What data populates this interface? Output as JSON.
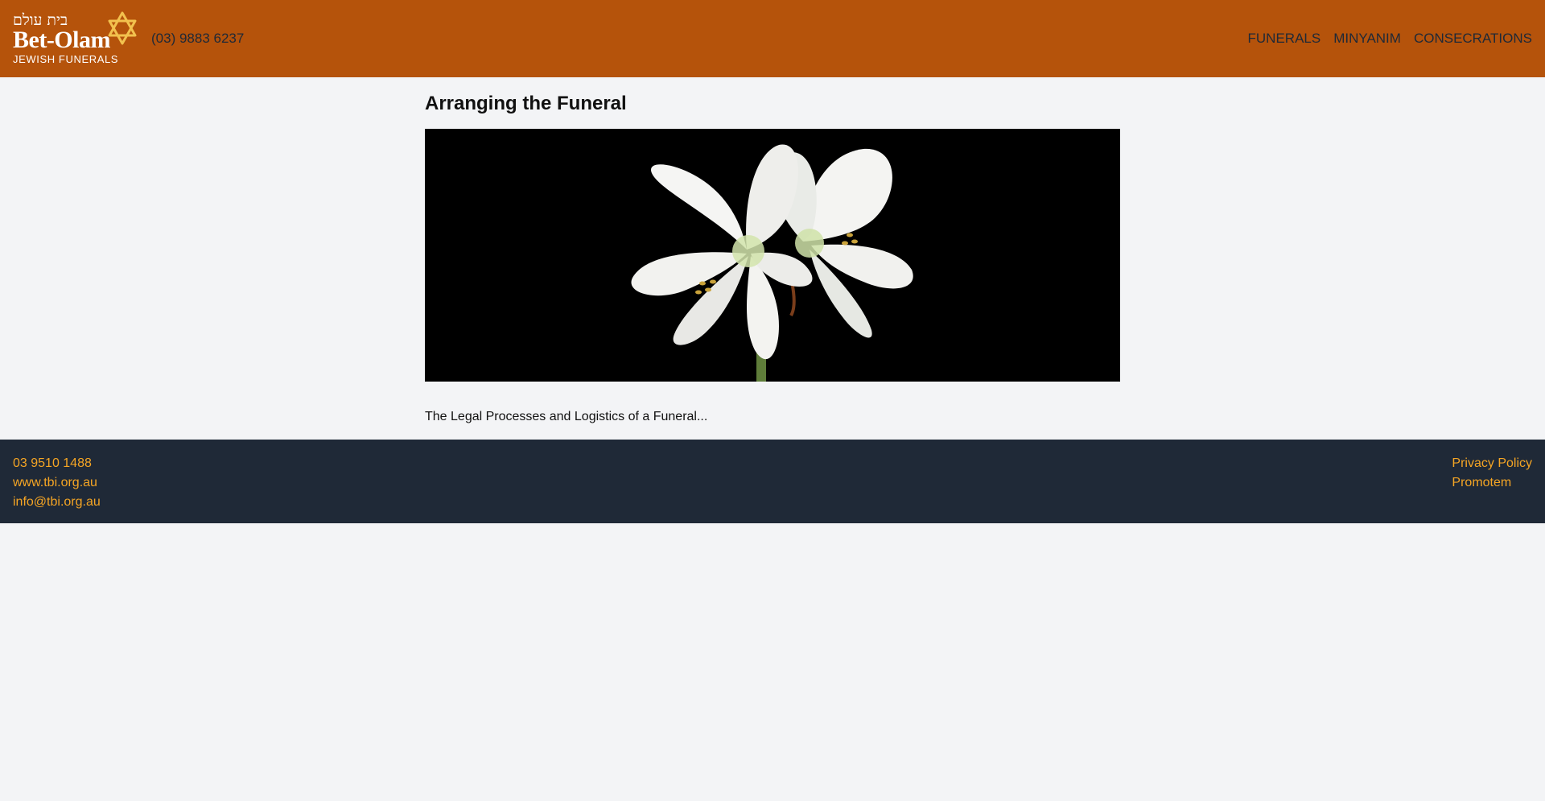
{
  "header": {
    "logo": {
      "hebrew": "בית עולם",
      "brand": "Bet-Olam",
      "tagline": "JEWISH FUNERALS",
      "icon": "star-of-david-icon"
    },
    "phone": "(03) 9883 6237",
    "nav": [
      "FUNERALS",
      "MINYANIM",
      "CONSECRATIONS"
    ]
  },
  "main": {
    "title": "Arranging the Funeral",
    "hero_image": "white lily flowers on black background",
    "intro": "The Legal Processes and Logistics of a Funeral..."
  },
  "footer": {
    "contact": [
      "03 9510 1488",
      "www.tbi.org.au",
      "info@tbi.org.au"
    ],
    "links": [
      "Privacy Policy",
      "Promotem"
    ]
  },
  "colors": {
    "header_bg": "#b5530b",
    "page_bg": "#f3f4f6",
    "footer_bg": "#1f2937",
    "footer_link": "#f5a524",
    "logo_star": "#f2c14e"
  }
}
